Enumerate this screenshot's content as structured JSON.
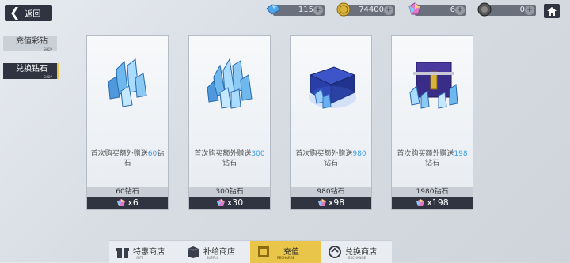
{
  "header": {
    "back_label": "返回",
    "resources": [
      {
        "icon": "diamond-icon",
        "value": "115"
      },
      {
        "icon": "gold-coin-icon",
        "value": "74400"
      },
      {
        "icon": "color-diamond-icon",
        "value": "6"
      },
      {
        "icon": "token-icon",
        "value": "0"
      }
    ],
    "home_icon": "home-icon"
  },
  "side_tabs": [
    {
      "label": "充值彩钻",
      "sub": "SHOP",
      "active": false
    },
    {
      "label": "兑换钻石",
      "sub": "SHOP",
      "active": true
    }
  ],
  "cards": [
    {
      "image": "small-crystal-cluster",
      "desc_prefix": "首次购买额外赠送",
      "desc_amount": "60",
      "desc_suffix": "钻石",
      "price": "60钻石",
      "reward": "x6"
    },
    {
      "image": "large-crystal-cluster",
      "desc_prefix": "首次购买额外赠送",
      "desc_amount": "300",
      "desc_suffix": "钻石",
      "price": "300钻石",
      "reward": "x30"
    },
    {
      "image": "crystal-box",
      "desc_prefix": "首次购买额外赠送",
      "desc_amount": "980",
      "desc_suffix": "钻石",
      "price": "980钻石",
      "reward": "x98"
    },
    {
      "image": "crystal-chest",
      "desc_prefix": "首次购买额外赠送",
      "desc_amount": "198",
      "desc_suffix": "钻石",
      "price": "1980钻石",
      "reward": "x198"
    }
  ],
  "bottom_tabs": [
    {
      "label": "特惠商店",
      "en": "GIFT",
      "icon": "gift-icon",
      "active": false
    },
    {
      "label": "补给商店",
      "en": "SUPPLY",
      "icon": "supply-box-icon",
      "active": false
    },
    {
      "label": "充值",
      "en": "RECHARGE",
      "icon": "recharge-icon",
      "active": true
    },
    {
      "label": "兑换商店",
      "en": "EXCHANGE",
      "icon": "exchange-icon",
      "active": false
    }
  ],
  "colors": {
    "accent": "#e9c64a",
    "dark": "#2f3440",
    "highlight": "#3aa0e8"
  }
}
